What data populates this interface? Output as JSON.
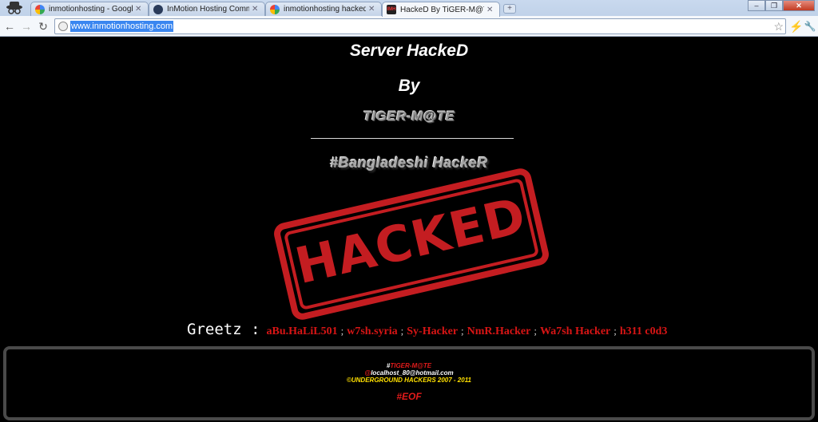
{
  "browser": {
    "tabs": [
      {
        "title": "inmotionhosting - Google S",
        "favicon": "google-icon",
        "active": false
      },
      {
        "title": "InMotion Hosting Commun",
        "favicon": "inmotion-icon",
        "active": false
      },
      {
        "title": "inmotionhosting hacked - G",
        "favicon": "google-icon",
        "active": false
      },
      {
        "title": "HackeD By TiGER-M@TE",
        "favicon": "imh-icon",
        "favicon_text": "IMH",
        "active": true
      }
    ],
    "new_tab_label": "+",
    "window_buttons": {
      "minimize": "–",
      "restore": "❐",
      "close": "✕"
    },
    "url": "www.inmotionhosting.com",
    "back_glyph": "←",
    "forward_glyph": "→",
    "reload_glyph": "↻",
    "star_glyph": "☆",
    "extension_glyph": "⚡",
    "wrench_glyph": "🔧"
  },
  "page": {
    "title_line1": "Server HackeD",
    "title_line2": "By",
    "hacker_name": "TIGER-M@TE",
    "team": "#Bangladeshi HackeR",
    "stamp_text": "HACKED",
    "greetz_label": "Greetz :",
    "greetz": [
      "aBu.HaLiL501",
      "w7sh.syria",
      "Sy-Hacker",
      "NmR.Hacker",
      "Wa7sh Hacker",
      "h311 c0d3"
    ],
    "greetz_separator": ";",
    "footer": {
      "line1_prefix": "#",
      "line1_name": "TIGER-M@TE",
      "line2_prefix": "@",
      "line2_text": "localhost_80@hotmail.com",
      "line3": "©UNDERGROUND HACKERS 2007 - 2011",
      "eof": "#EOF"
    }
  },
  "colors": {
    "background": "#000000",
    "stamp_red": "#c41d21",
    "greetz_red": "#d81515",
    "footer_yellow": "#ffe000"
  }
}
